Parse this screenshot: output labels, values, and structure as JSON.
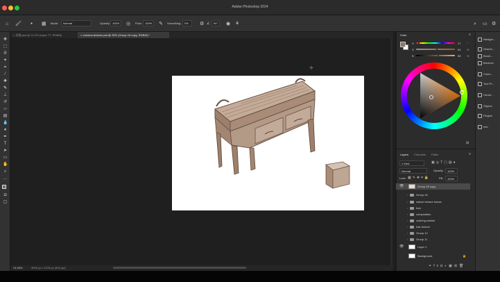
{
  "window": {
    "title": "Adobe Photoshop 2024"
  },
  "options_bar": {
    "mode_label": "Mode:",
    "mode_value": "Normal",
    "opacity_label": "Opacity:",
    "opacity_value": "100%",
    "flow_label": "Flow:",
    "flow_value": "100%",
    "smoothing_label": "Smoothing:",
    "smoothing_value": "0%",
    "angle_value": "90°",
    "share_label": "Share"
  },
  "tabs": [
    {
      "label": "文档.psd @ 11.2% (Layer 77, RGB/8)",
      "active": false
    },
    {
      "label": "colorme-texture.psd @ 25% (Group 15 copy, RGB/8) *",
      "active": true
    }
  ],
  "status": {
    "zoom": "24.98%",
    "doc_info": "3000 px x 2378 px (300 ppi)"
  },
  "color_panel": {
    "title": "Color",
    "hsb": [
      {
        "label": "H",
        "value": "27",
        "unit": "°",
        "fraction": 0.08
      },
      {
        "label": "S",
        "value": "54",
        "unit": "%",
        "fraction": 0.54
      },
      {
        "label": "B",
        "value": "58",
        "unit": "%",
        "fraction": 0.58
      }
    ]
  },
  "layers_panel": {
    "tabs": [
      "Layers",
      "Channels",
      "Paths"
    ],
    "filter_label": "Kind",
    "blend_mode": "Normal",
    "opacity_label": "Opacity:",
    "opacity_value": "100%",
    "lock_label": "Lock:",
    "fill_label": "Fill:",
    "fill_value": "100%",
    "layers": [
      {
        "name": "Group 15 copy",
        "type": "group-thumb",
        "visible": true,
        "selected": true
      },
      {
        "name": "Group 16",
        "type": "folder",
        "visible": false,
        "selected": false
      },
      {
        "name": "nature texture traces",
        "type": "folder",
        "visible": false,
        "selected": false
      },
      {
        "name": "tree",
        "type": "folder",
        "visible": false,
        "selected": false
      },
      {
        "name": "composition",
        "type": "folder",
        "visible": false,
        "selected": false
      },
      {
        "name": "clothing wrinkle",
        "type": "folder",
        "visible": false,
        "selected": false
      },
      {
        "name": "hair texture",
        "type": "folder",
        "visible": false,
        "selected": false
      },
      {
        "name": "Group 12",
        "type": "folder",
        "visible": false,
        "selected": false
      },
      {
        "name": "Group 11",
        "type": "folder",
        "visible": false,
        "selected": false
      },
      {
        "name": "Layer 1",
        "type": "layer",
        "visible": true,
        "selected": false
      },
      {
        "name": "Background",
        "type": "layer",
        "visible": false,
        "selected": false
      }
    ]
  },
  "right_dock": [
    {
      "label": "Navigat..."
    },
    {
      "label": "Search..."
    },
    {
      "label": "Brush..."
    },
    {
      "label": "Brushes"
    },
    {
      "label": "Clone..."
    },
    {
      "label": "Tool Pr..."
    },
    {
      "label": "Librari..."
    },
    {
      "label": "Glyphs"
    },
    {
      "label": "Plugins"
    },
    {
      "label": "Info"
    }
  ],
  "colors": {
    "accent": "#1473e6",
    "wood": "#b59a86"
  }
}
